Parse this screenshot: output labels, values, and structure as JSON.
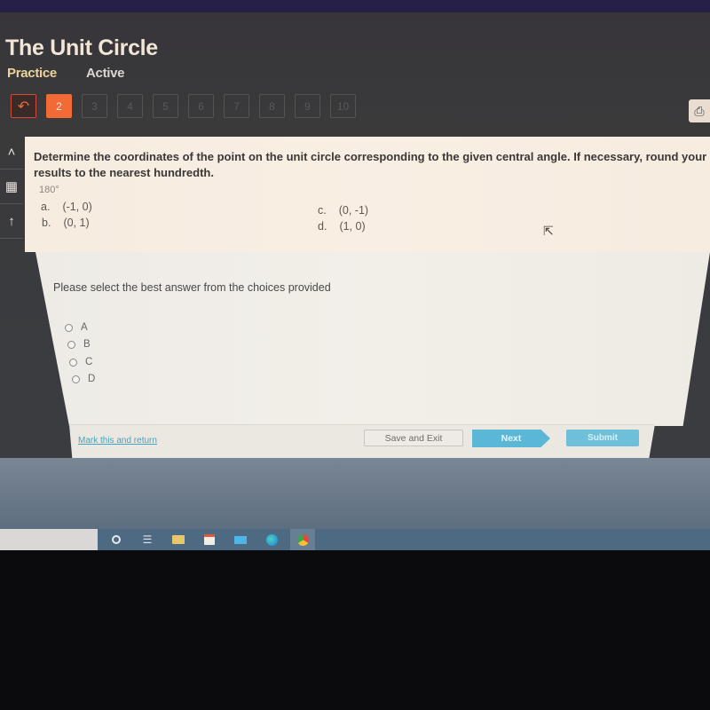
{
  "app": {
    "title": "The Unit Circle",
    "tabs": [
      {
        "label": "Practice",
        "state": "selected"
      },
      {
        "label": "Active",
        "state": "normal"
      }
    ]
  },
  "question_nav": {
    "back_icon": "undo-arrow-icon",
    "current": "2",
    "items": [
      "2",
      "3",
      "4",
      "5",
      "6",
      "7",
      "8",
      "9",
      "10"
    ]
  },
  "toolbar": {
    "print_icon": "printer-icon"
  },
  "sidebar": {
    "items": [
      {
        "icon": "chevron-up-icon",
        "glyph": "˄"
      },
      {
        "icon": "calculator-icon",
        "glyph": "▦"
      },
      {
        "icon": "arrow-up-icon",
        "glyph": "↑"
      }
    ]
  },
  "question": {
    "text": "Determine the coordinates of the point on the unit circle corresponding to the given central angle. If necessary, round your results to the nearest hundredth.",
    "angle": "180°",
    "choices": [
      {
        "letter": "a.",
        "value": "(-1, 0)"
      },
      {
        "letter": "b.",
        "value": "(0, 1)"
      },
      {
        "letter": "c.",
        "value": "(0, -1)"
      },
      {
        "letter": "d.",
        "value": "(1, 0)"
      }
    ]
  },
  "answer": {
    "instruction": "Please select the best answer from the choices provided",
    "options": [
      "A",
      "B",
      "C",
      "D"
    ],
    "selected": null
  },
  "footer": {
    "mark_link": "Mark this and return",
    "save_exit": "Save and Exit",
    "next": "Next",
    "submit": "Submit"
  },
  "colors": {
    "accent_orange": "#f26a36",
    "button_blue": "#5bb7d6",
    "link_teal": "#4aa0b8"
  },
  "taskbar": {
    "icons": [
      "cortana-circle-icon",
      "task-view-icon",
      "file-explorer-icon",
      "store-icon",
      "mail-icon",
      "edge-icon",
      "chrome-icon"
    ]
  }
}
